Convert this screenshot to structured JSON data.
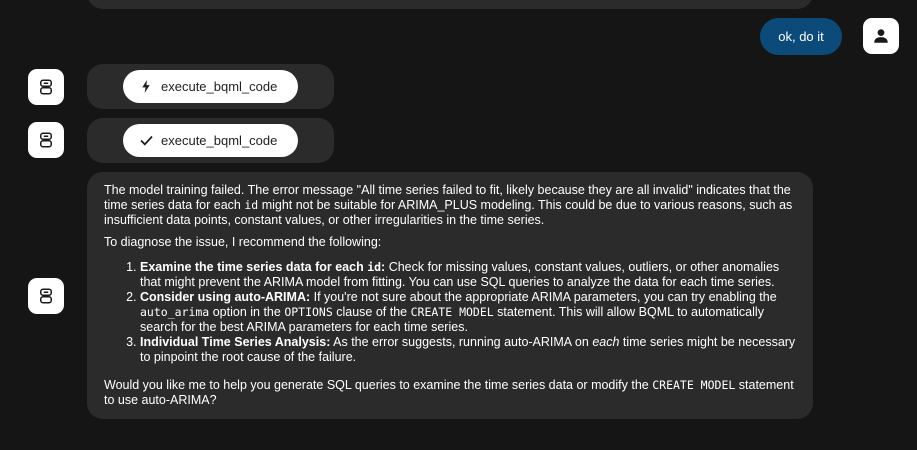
{
  "user": {
    "message": "ok, do it"
  },
  "tools": [
    {
      "name": "execute_bqml_code",
      "status": "running",
      "icon": "bolt-icon"
    },
    {
      "name": "execute_bqml_code",
      "status": "done",
      "icon": "check-icon"
    }
  ],
  "assistant": {
    "p1": {
      "a": "The model training failed. The error message \"All time series failed to fit, likely because they are all invalid\" indicates that the time series data for each ",
      "code": "id",
      "b": " might not be suitable for ARIMA_PLUS modeling. This could be due to various reasons, such as insufficient data points, constant values, or other irregularities in the time series."
    },
    "p2": "To diagnose the issue, I recommend the following:",
    "items": [
      {
        "bold_a": "Examine the time series data for each ",
        "bold_code": "id",
        "bold_b": ":",
        "text": " Check for missing values, constant values, outliers, or other anomalies that might prevent the ARIMA model from fitting. You can use SQL queries to analyze the data for each time series."
      },
      {
        "bold": "Consider using auto-ARIMA:",
        "t1": " If you're not sure about the appropriate ARIMA parameters, you can try enabling the ",
        "c1": "auto_arima",
        "t2": " option in the ",
        "c2": "OPTIONS",
        "t3": " clause of the ",
        "c3": "CREATE MODEL",
        "t4": " statement. This will allow BQML to automatically search for the best ARIMA parameters for each time series."
      },
      {
        "bold": "Individual Time Series Analysis:",
        "t1": " As the error suggests, running auto-ARIMA on ",
        "em": "each",
        "t2": " time series might be necessary to pinpoint the root cause of the failure."
      }
    ],
    "p3": {
      "a": "Would you like me to help you generate SQL queries to examine the time series data or modify the ",
      "code": "CREATE MODEL",
      "b": " statement to use auto-ARIMA?"
    }
  },
  "colors": {
    "background": "#151515",
    "bubble": "#2b2b2b",
    "user_bubble": "#0c4a7a",
    "chip": "#ffffff"
  }
}
